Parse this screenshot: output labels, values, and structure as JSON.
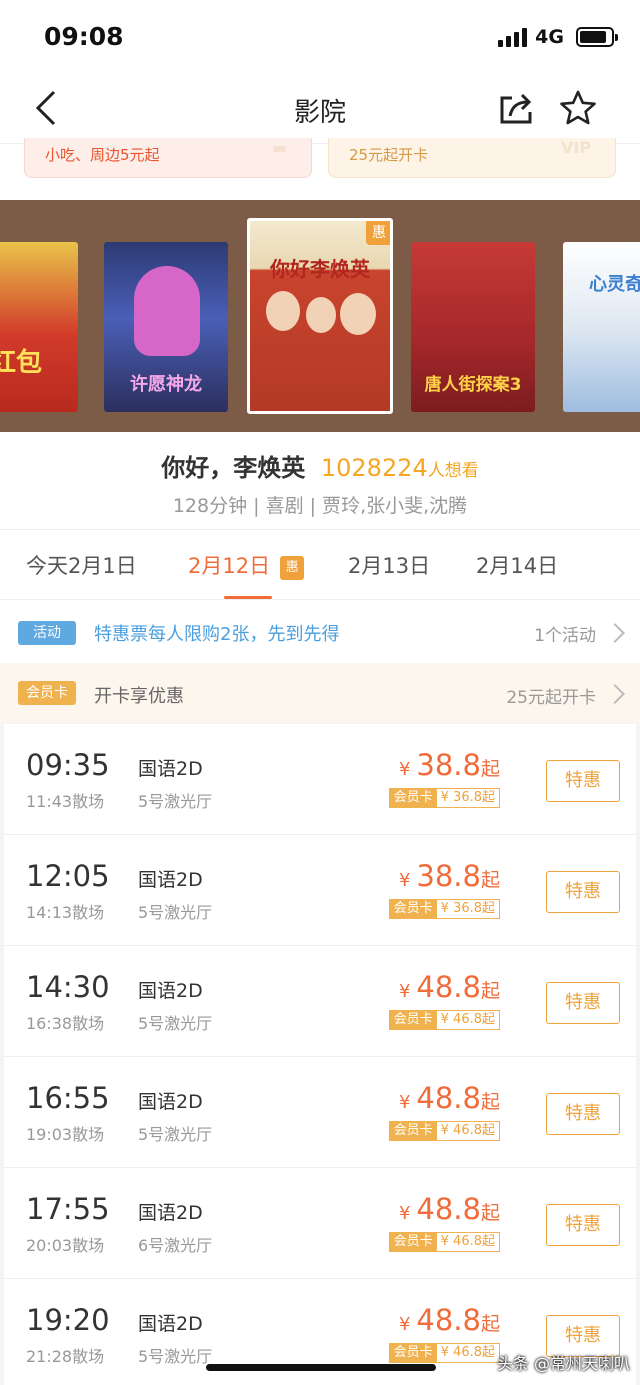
{
  "status_bar": {
    "time": "09:08",
    "network": "4G"
  },
  "nav": {
    "title": "影院",
    "back_icon": "back-arrow-icon",
    "share_icon": "share-icon",
    "favorite_icon": "star-icon"
  },
  "promos": [
    {
      "text": "小吃、周边5元起"
    },
    {
      "text": "25元起开卡",
      "deco": "VIP"
    }
  ],
  "posters": [
    {
      "title": "红包",
      "bg": "#d13a2a",
      "badge": ""
    },
    {
      "title": "许愿神龙",
      "bg": "#4a5fb6",
      "badge": ""
    },
    {
      "title": "你好李焕英",
      "bg": "#c9442d",
      "badge": "惠",
      "selected": true
    },
    {
      "title": "唐人街探案3",
      "bg": "#a4272a",
      "badge": ""
    },
    {
      "title": "心灵奇旅",
      "bg": "#dfe8f2",
      "badge": ""
    }
  ],
  "movie": {
    "name": "你好，李焕英",
    "want_count": "1028224",
    "want_label": "人想看",
    "meta": "128分钟 | 喜剧 | 贾玲,张小斐,沈腾"
  },
  "dates": [
    {
      "label": "今天2月1日",
      "active": false
    },
    {
      "label": "2月12日",
      "active": true,
      "badge": "惠"
    },
    {
      "label": "2月13日",
      "active": false
    },
    {
      "label": "2月14日",
      "active": false
    }
  ],
  "activity": {
    "tag": "活动",
    "text": "特惠票每人限购2张，先到先得",
    "count": "1个活动"
  },
  "member_card": {
    "tag": "会员卡",
    "text": "开卡享优惠",
    "price": "25元起开卡"
  },
  "sessions": [
    {
      "time": "09:35",
      "end": "11:43散场",
      "lang": "国语2D",
      "hall": "5号激光厅",
      "price": "38.8",
      "member_price": "¥ 36.8起",
      "button": "特惠"
    },
    {
      "time": "12:05",
      "end": "14:13散场",
      "lang": "国语2D",
      "hall": "5号激光厅",
      "price": "38.8",
      "member_price": "¥ 36.8起",
      "button": "特惠"
    },
    {
      "time": "14:30",
      "end": "16:38散场",
      "lang": "国语2D",
      "hall": "5号激光厅",
      "price": "48.8",
      "member_price": "¥ 46.8起",
      "button": "特惠"
    },
    {
      "time": "16:55",
      "end": "19:03散场",
      "lang": "国语2D",
      "hall": "5号激光厅",
      "price": "48.8",
      "member_price": "¥ 46.8起",
      "button": "特惠"
    },
    {
      "time": "17:55",
      "end": "20:03散场",
      "lang": "国语2D",
      "hall": "6号激光厅",
      "price": "48.8",
      "member_price": "¥ 46.8起",
      "button": "特惠"
    },
    {
      "time": "19:20",
      "end": "21:28散场",
      "lang": "国语2D",
      "hall": "5号激光厅",
      "price": "48.8",
      "member_price": "¥ 46.8起",
      "button": "特惠"
    }
  ],
  "price_prefix": "¥",
  "price_suffix": "起",
  "member_tag": "会员卡",
  "watermark": "头条 @常州天喇叭",
  "colors": {
    "accent": "#f06c3a",
    "gold": "#f0a13a",
    "link": "#4a9fde",
    "strip": "#7d5c47"
  }
}
